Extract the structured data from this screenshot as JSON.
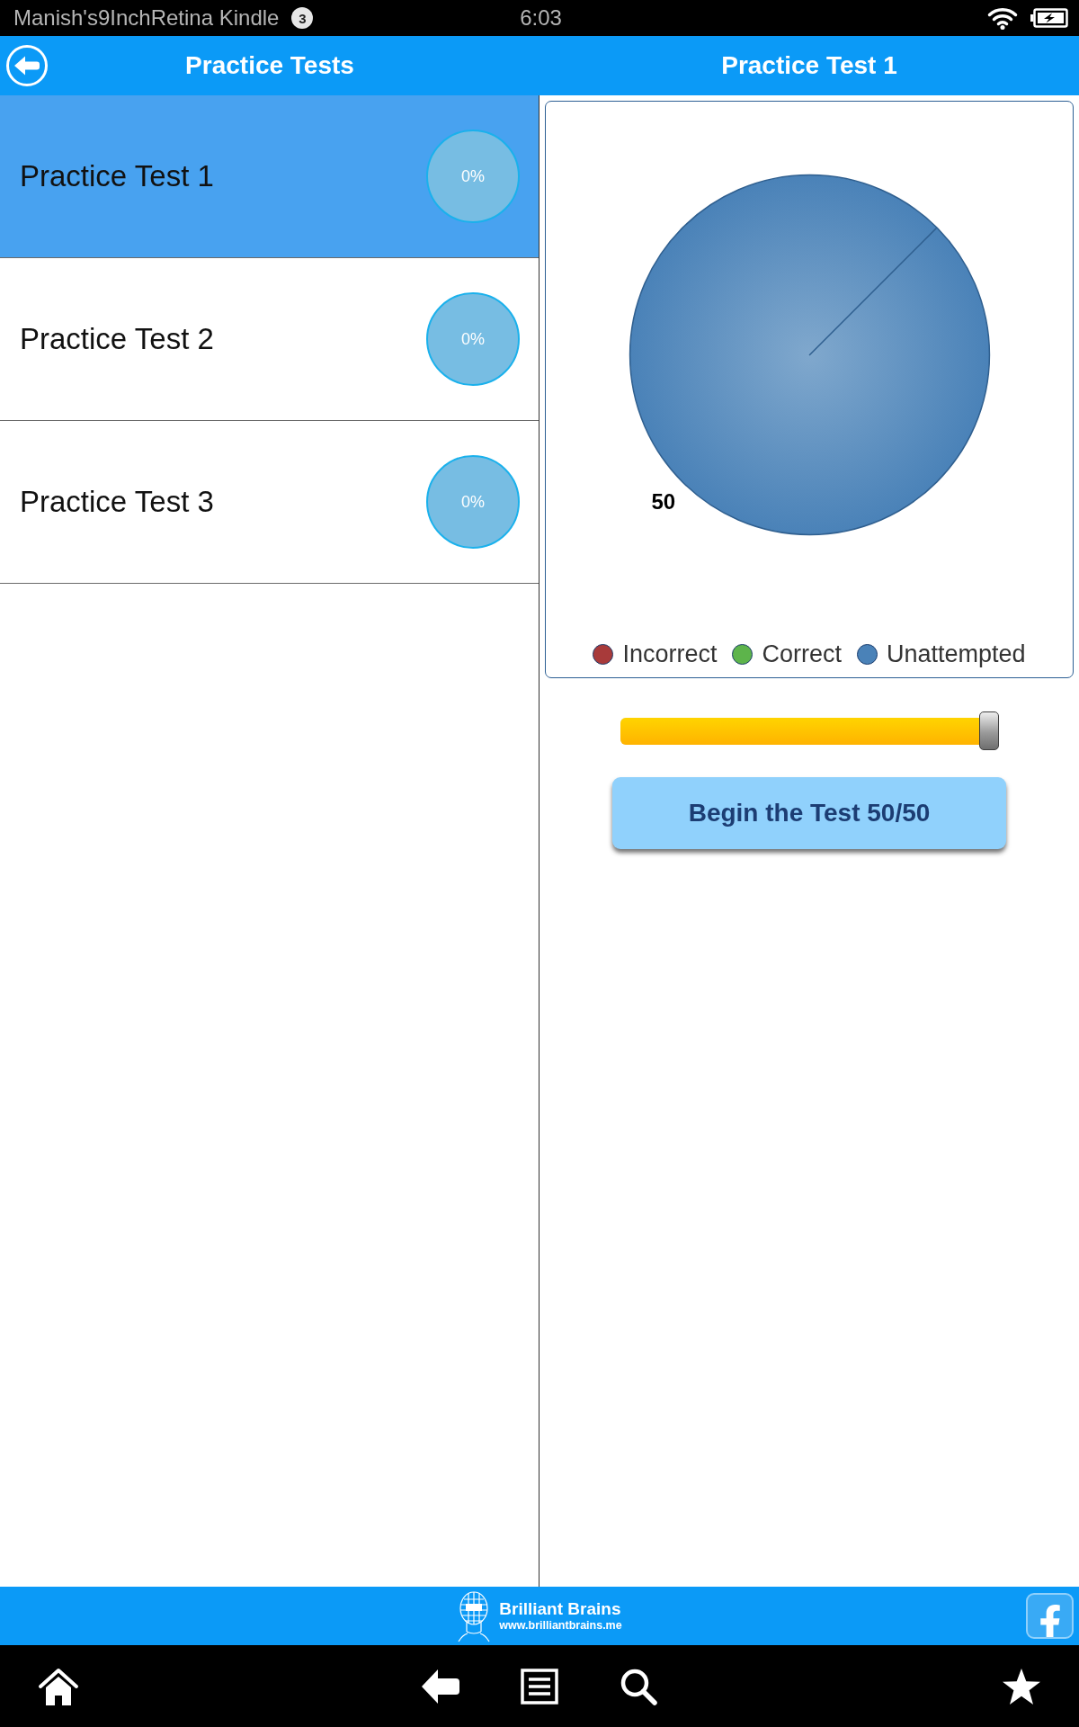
{
  "status_bar": {
    "device_name": "Manish's9InchRetina Kindle",
    "notification_count": "3",
    "time": "6:03"
  },
  "header": {
    "left_title": "Practice Tests",
    "right_title": "Practice Test 1"
  },
  "tests": [
    {
      "title": "Practice Test 1",
      "progress": "0%",
      "selected": true
    },
    {
      "title": "Practice Test 2",
      "progress": "0%",
      "selected": false
    },
    {
      "title": "Practice Test 3",
      "progress": "0%",
      "selected": false
    }
  ],
  "detail": {
    "chart": {
      "chart_data": {
        "type": "pie",
        "categories": [
          "Incorrect",
          "Correct",
          "Unattempted"
        ],
        "values": [
          0,
          0,
          50
        ],
        "data_labels": true
      },
      "legend": [
        {
          "color": "#a83a3a"
        },
        {
          "color": "#5db44b"
        },
        {
          "color": "#4a82b8"
        }
      ]
    },
    "slider": {
      "level": 1
    },
    "start_button": "Begin the Test 50/50"
  },
  "footer": {
    "brand": "Brilliant Brains",
    "website": "www.brilliantbrains.me"
  }
}
